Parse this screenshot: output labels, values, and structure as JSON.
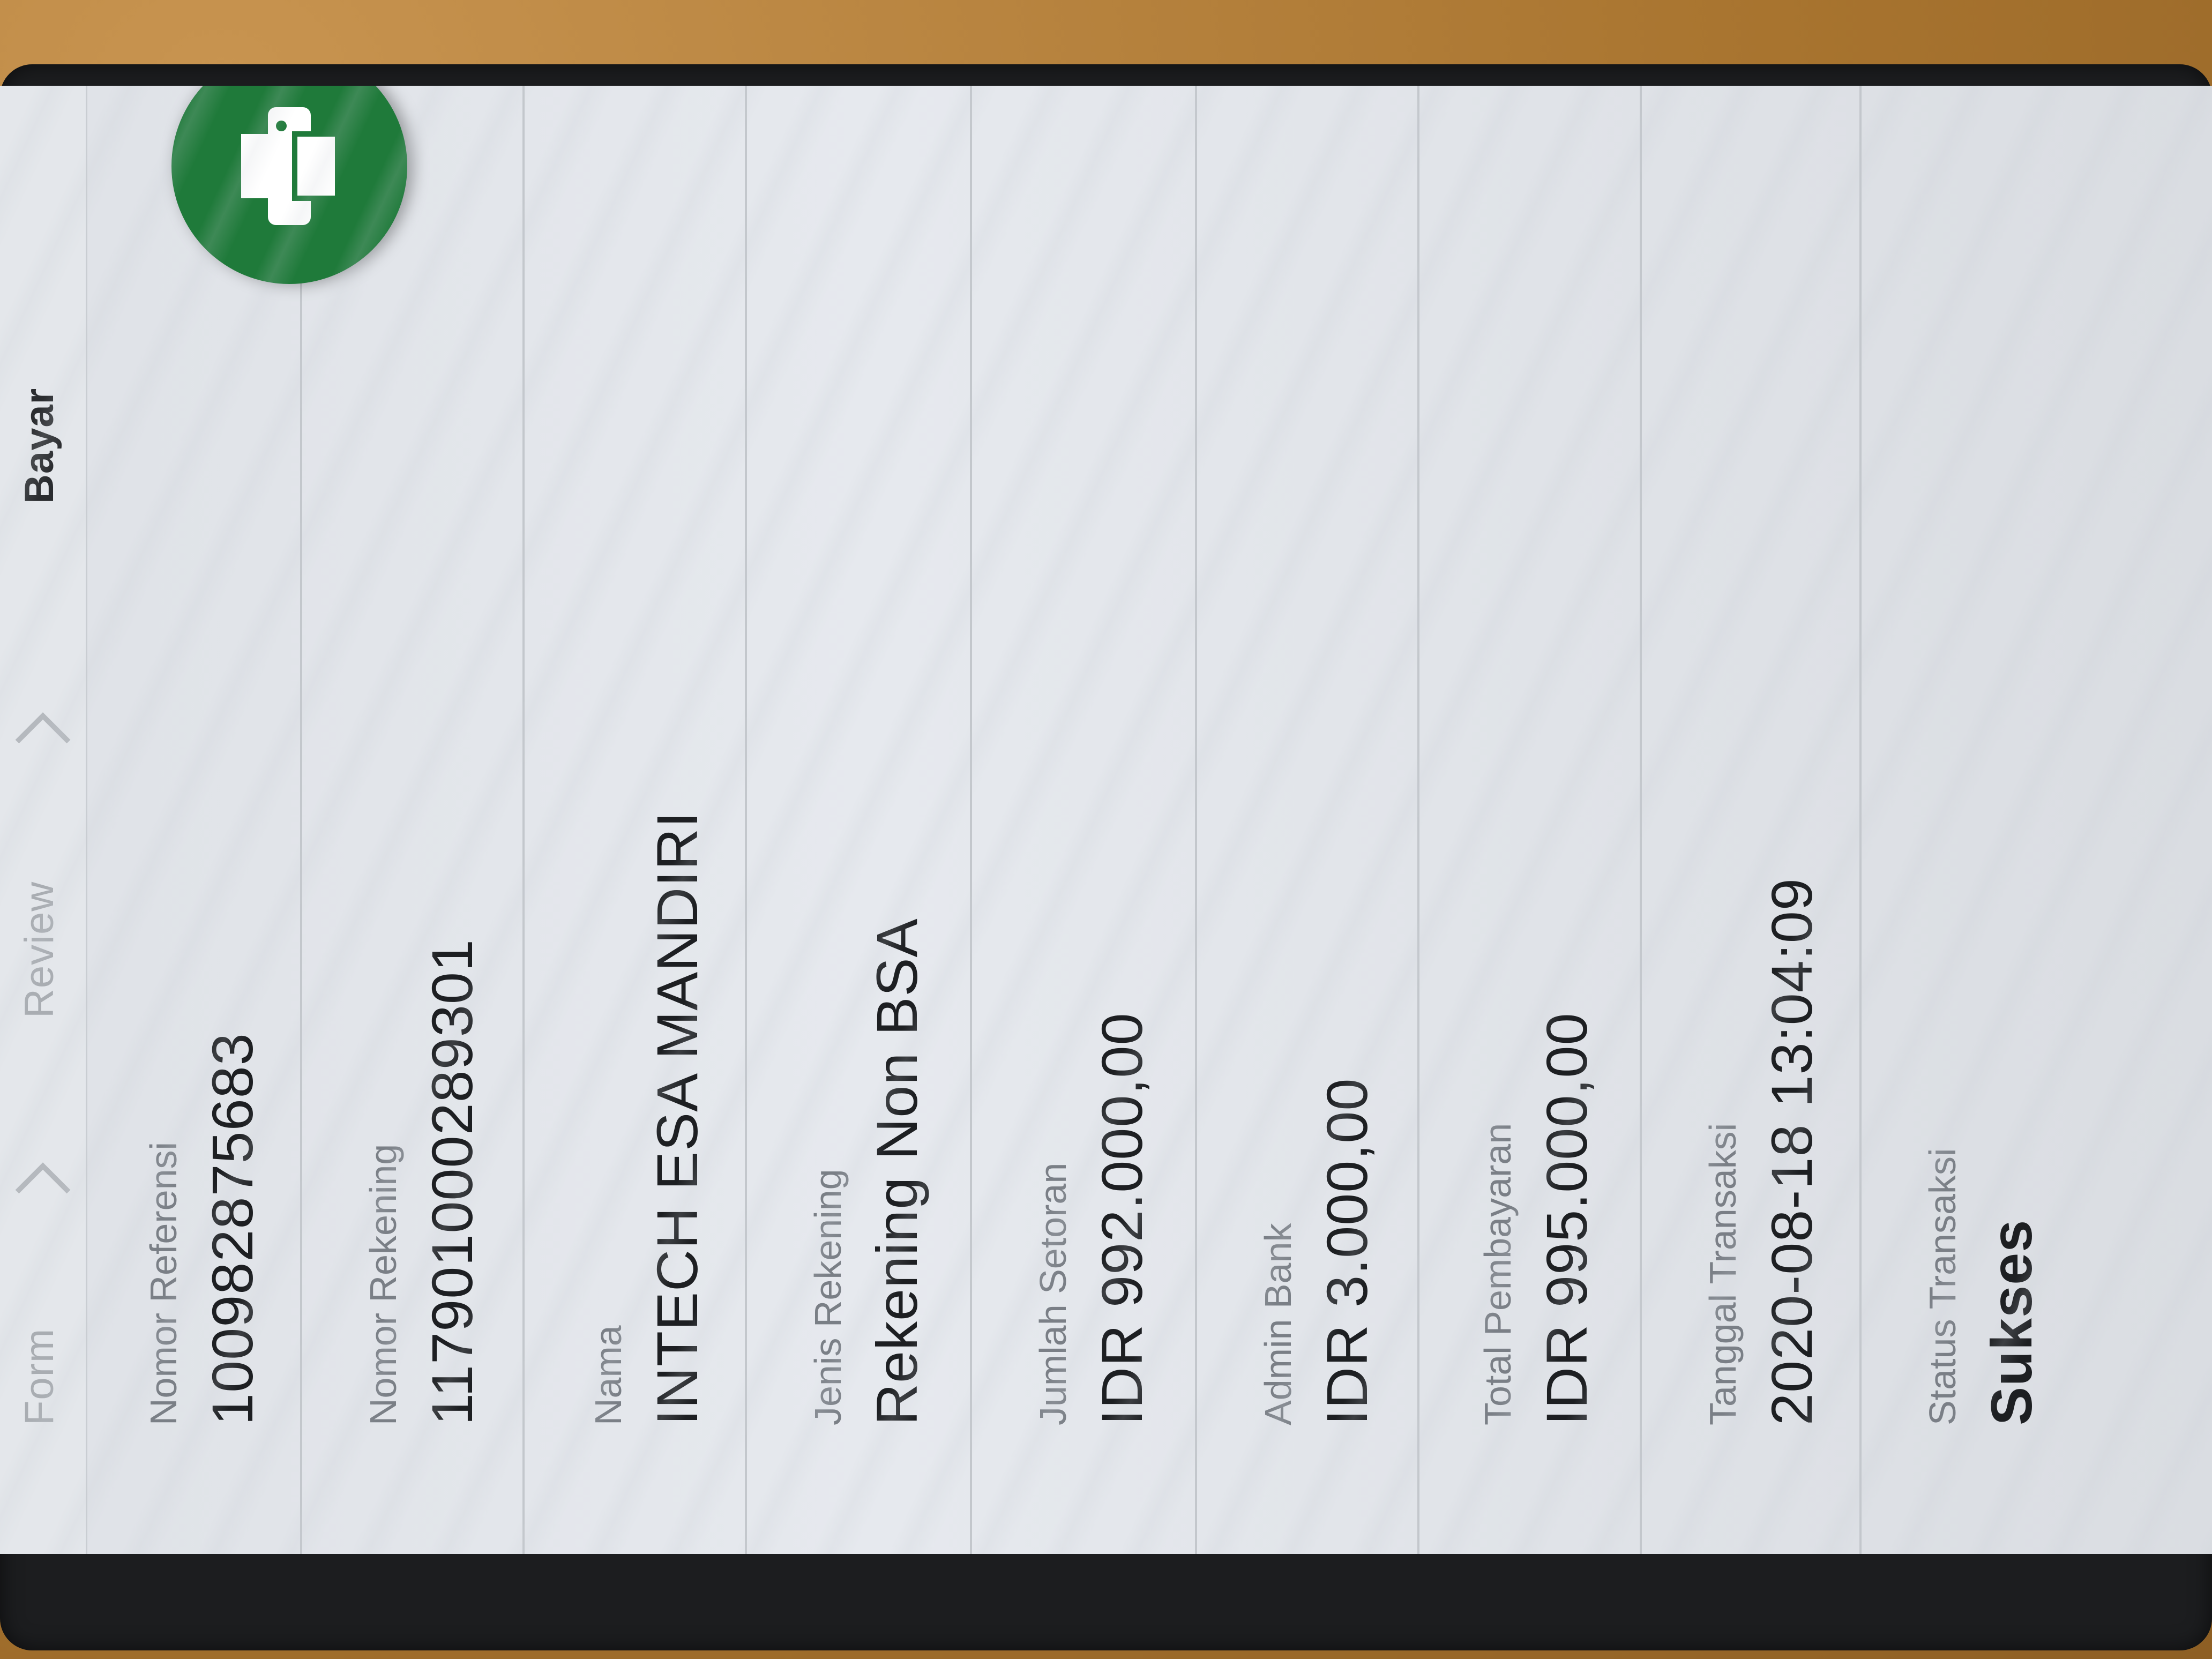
{
  "stepper": {
    "steps": [
      "Form",
      "Review",
      "Bayar"
    ],
    "active_index": 2
  },
  "fields": [
    {
      "label": "Nomor Referensi",
      "value": "100982875683"
    },
    {
      "label": "Nomor Rekening",
      "value": "117901000289301"
    },
    {
      "label": "Nama",
      "value": "INTECH ESA MANDIRI"
    },
    {
      "label": "Jenis Rekening",
      "value": "Rekening Non BSA"
    },
    {
      "label": "Jumlah Setoran",
      "value": "IDR 992.000,00"
    },
    {
      "label": "Admin Bank",
      "value": "IDR 3.000,00"
    },
    {
      "label": "Total Pembayaran",
      "value": "IDR 995.000,00"
    },
    {
      "label": "Tanggal Transaksi",
      "value": "2020-08-18 13:04:09"
    },
    {
      "label": "Status Transaksi",
      "value": "Sukses"
    }
  ],
  "fab": {
    "icon": "printer-icon",
    "color": "#1f7a3a"
  }
}
